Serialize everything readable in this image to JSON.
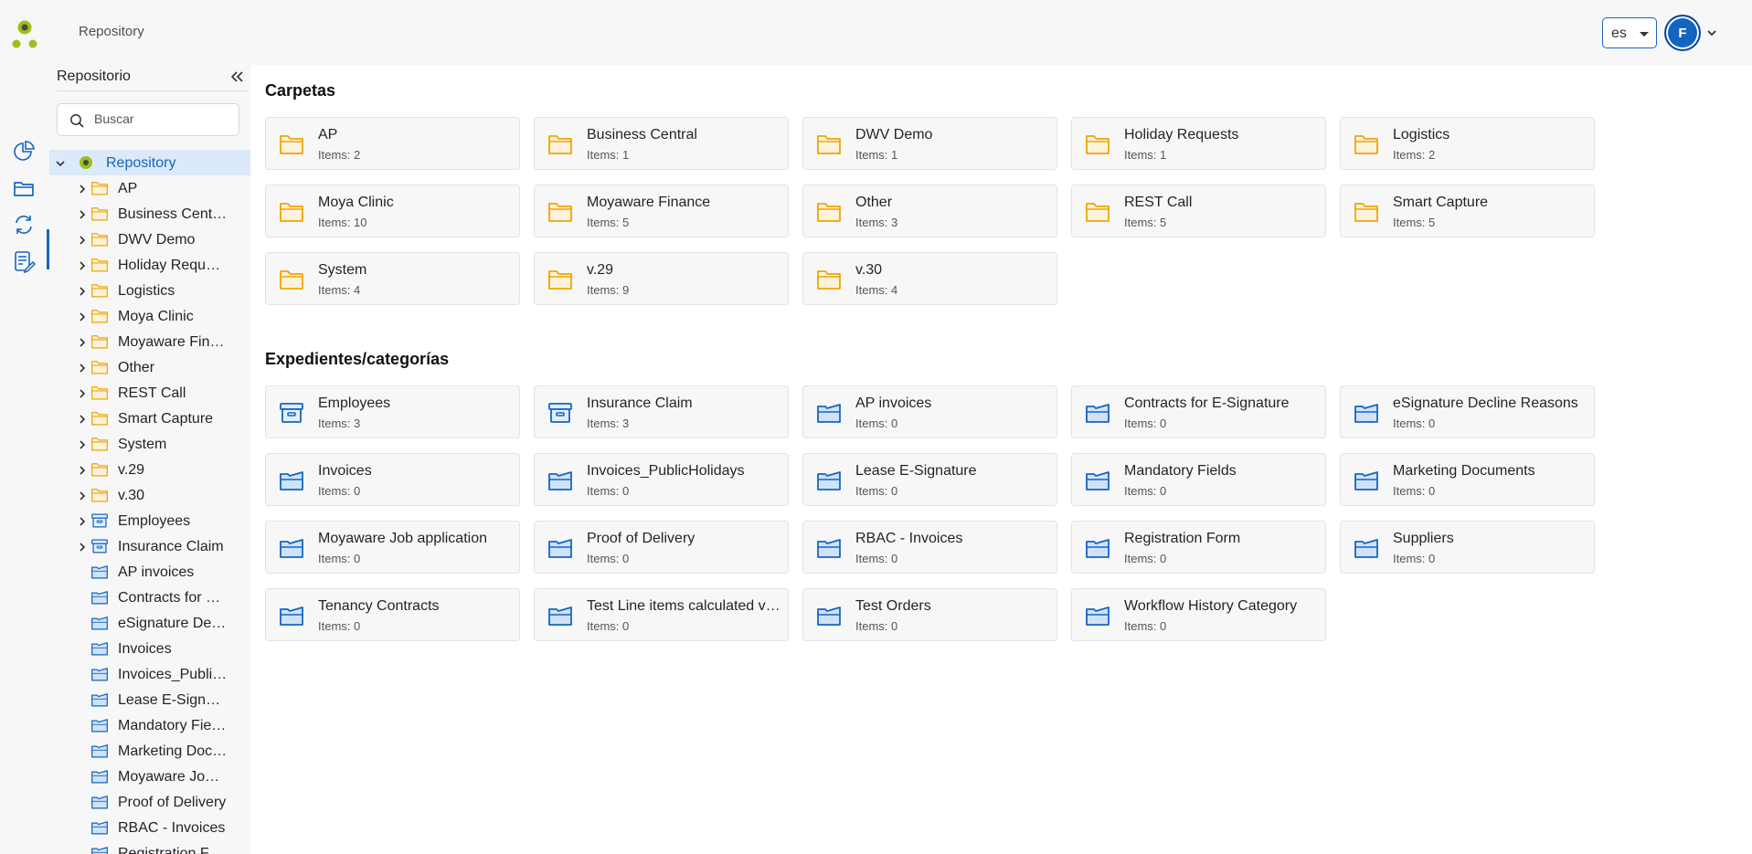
{
  "header": {
    "breadcrumb": "Repository",
    "language": "es",
    "avatar_initial": "F"
  },
  "rail": {
    "items": [
      {
        "icon": "dashboard-pie-icon"
      },
      {
        "icon": "folder-icon",
        "active": true
      },
      {
        "icon": "sync-icon"
      },
      {
        "icon": "tasks-icon"
      }
    ]
  },
  "tree": {
    "title": "Repositorio",
    "search_placeholder": "Buscar",
    "root": "Repository",
    "items": [
      {
        "label": "AP",
        "type": "folder",
        "expandable": true
      },
      {
        "label": "Business Central",
        "type": "folder",
        "expandable": true
      },
      {
        "label": "DWV Demo",
        "type": "folder",
        "expandable": true
      },
      {
        "label": "Holiday Requests",
        "type": "folder",
        "expandable": true
      },
      {
        "label": "Logistics",
        "type": "folder",
        "expandable": true
      },
      {
        "label": "Moya Clinic",
        "type": "folder",
        "expandable": true
      },
      {
        "label": "Moyaware Finance",
        "type": "folder",
        "expandable": true
      },
      {
        "label": "Other",
        "type": "folder",
        "expandable": true
      },
      {
        "label": "REST Call",
        "type": "folder",
        "expandable": true
      },
      {
        "label": "Smart Capture",
        "type": "folder",
        "expandable": true
      },
      {
        "label": "System",
        "type": "folder",
        "expandable": true
      },
      {
        "label": "v.29",
        "type": "folder",
        "expandable": true
      },
      {
        "label": "v.30",
        "type": "folder",
        "expandable": true
      },
      {
        "label": "Employees",
        "type": "archive",
        "expandable": true
      },
      {
        "label": "Insurance Claim",
        "type": "archive",
        "expandable": true
      },
      {
        "label": "AP invoices",
        "type": "category",
        "expandable": false
      },
      {
        "label": "Contracts for E-Signature",
        "type": "category",
        "expandable": false
      },
      {
        "label": "eSignature Decline Reasons",
        "type": "category",
        "expandable": false
      },
      {
        "label": "Invoices",
        "type": "category",
        "expandable": false
      },
      {
        "label": "Invoices_PublicHolidays",
        "type": "category",
        "expandable": false
      },
      {
        "label": "Lease E-Signature",
        "type": "category",
        "expandable": false
      },
      {
        "label": "Mandatory Fields",
        "type": "category",
        "expandable": false
      },
      {
        "label": "Marketing Documents",
        "type": "category",
        "expandable": false
      },
      {
        "label": "Moyaware Job application",
        "type": "category",
        "expandable": false
      },
      {
        "label": "Proof of Delivery",
        "type": "category",
        "expandable": false
      },
      {
        "label": "RBAC - Invoices",
        "type": "category",
        "expandable": false
      },
      {
        "label": "Registration Form",
        "type": "category",
        "expandable": false
      }
    ]
  },
  "folders_section": {
    "title": "Carpetas",
    "cards": [
      {
        "name": "AP",
        "count": "Items: 2",
        "type": "folder"
      },
      {
        "name": "Business Central",
        "count": "Items: 1",
        "type": "folder"
      },
      {
        "name": "DWV Demo",
        "count": "Items: 1",
        "type": "folder"
      },
      {
        "name": "Holiday Requests",
        "count": "Items: 1",
        "type": "folder"
      },
      {
        "name": "Logistics",
        "count": "Items: 2",
        "type": "folder"
      },
      {
        "name": "Moya Clinic",
        "count": "Items: 10",
        "type": "folder"
      },
      {
        "name": "Moyaware Finance",
        "count": "Items: 5",
        "type": "folder"
      },
      {
        "name": "Other",
        "count": "Items: 3",
        "type": "folder"
      },
      {
        "name": "REST Call",
        "count": "Items: 5",
        "type": "folder"
      },
      {
        "name": "Smart Capture",
        "count": "Items: 5",
        "type": "folder"
      },
      {
        "name": "System",
        "count": "Items: 4",
        "type": "folder"
      },
      {
        "name": "v.29",
        "count": "Items: 9",
        "type": "folder"
      },
      {
        "name": "v.30",
        "count": "Items: 4",
        "type": "folder"
      }
    ]
  },
  "categories_section": {
    "title": "Expedientes/categorías",
    "cards": [
      {
        "name": "Employees",
        "count": "Items: 3",
        "type": "archive"
      },
      {
        "name": "Insurance Claim",
        "count": "Items: 3",
        "type": "archive"
      },
      {
        "name": "AP invoices",
        "count": "Items: 0",
        "type": "category"
      },
      {
        "name": "Contracts for E-Signature",
        "count": "Items: 0",
        "type": "category"
      },
      {
        "name": "eSignature Decline Reasons",
        "count": "Items: 0",
        "type": "category"
      },
      {
        "name": "Invoices",
        "count": "Items: 0",
        "type": "category"
      },
      {
        "name": "Invoices_PublicHolidays",
        "count": "Items: 0",
        "type": "category"
      },
      {
        "name": "Lease E-Signature",
        "count": "Items: 0",
        "type": "category"
      },
      {
        "name": "Mandatory Fields",
        "count": "Items: 0",
        "type": "category"
      },
      {
        "name": "Marketing Documents",
        "count": "Items: 0",
        "type": "category"
      },
      {
        "name": "Moyaware Job application",
        "count": "Items: 0",
        "type": "category"
      },
      {
        "name": "Proof of Delivery",
        "count": "Items: 0",
        "type": "category"
      },
      {
        "name": "RBAC - Invoices",
        "count": "Items: 0",
        "type": "category"
      },
      {
        "name": "Registration Form",
        "count": "Items: 0",
        "type": "category"
      },
      {
        "name": "Suppliers",
        "count": "Items: 0",
        "type": "category"
      },
      {
        "name": "Tenancy Contracts",
        "count": "Items: 0",
        "type": "category"
      },
      {
        "name": "Test Line items calculated values",
        "count": "Items: 0",
        "type": "category"
      },
      {
        "name": "Test Orders",
        "count": "Items: 0",
        "type": "category"
      },
      {
        "name": "Workflow History Category",
        "count": "Items: 0",
        "type": "category"
      }
    ]
  },
  "colors": {
    "accent": "#1565c0",
    "folder": "#f0a500",
    "category": "#1565c0",
    "logo_green": "#9bbf1e",
    "logo_dark": "#4a4a3a"
  }
}
